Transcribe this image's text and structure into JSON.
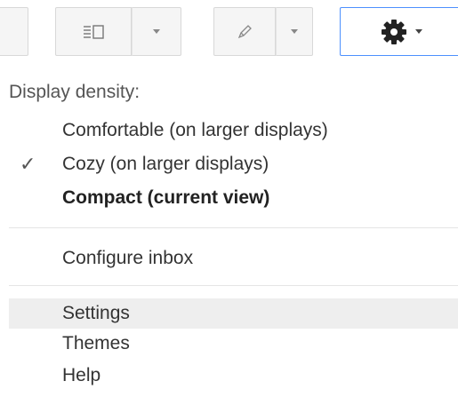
{
  "toolbar": {
    "view_button_icon": "split-pane-icon",
    "pen_button_icon": "pencil-icon",
    "settings_button_icon": "gear-icon",
    "accent_color": "#4d90fe"
  },
  "menu": {
    "heading": "Display density:",
    "density_options": [
      {
        "label": "Comfortable (on larger displays)",
        "checked": false,
        "bold": false
      },
      {
        "label": "Cozy (on larger displays)",
        "checked": true,
        "bold": false
      },
      {
        "label": "Compact (current view)",
        "checked": false,
        "bold": true
      }
    ],
    "configure_inbox": "Configure inbox",
    "settings": "Settings",
    "themes": "Themes",
    "help": "Help",
    "check_glyph": "✓",
    "highlight_color": "#eeeeee"
  }
}
